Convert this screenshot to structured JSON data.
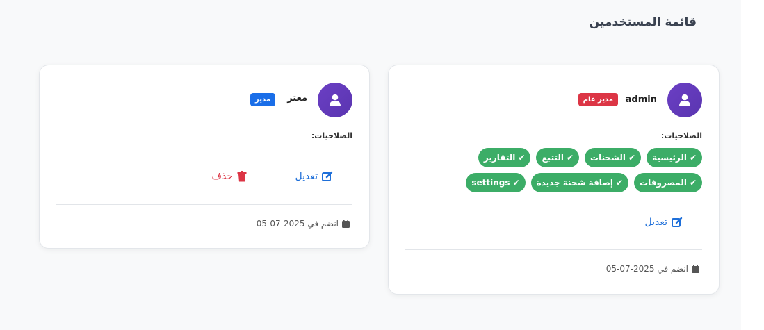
{
  "page": {
    "title": "قائمة المستخدمين"
  },
  "users": [
    {
      "name": "admin",
      "role": "مدير عام",
      "role_color": "#dc3545",
      "permissions_label": "الصلاحيات:",
      "permissions": [
        "الرئيسية",
        "الشحنات",
        "التتبع",
        "التقارير",
        "المصروفات",
        "إضافة شحنة جديدة",
        "settings"
      ],
      "edit_label": "تعديل",
      "joined_label": "انضم في 2025-07-05"
    },
    {
      "name": "معتز",
      "role": "مدير",
      "role_color": "#1a6ee8",
      "permissions_label": "الصلاحيات:",
      "permissions": [],
      "edit_label": "تعديل",
      "delete_label": "حذف",
      "joined_label": "انضم في 2025-07-05"
    }
  ],
  "icons": {
    "avatar": "user-icon",
    "check": "check-icon",
    "edit": "edit-icon",
    "delete": "trash-icon",
    "calendar": "calendar-icon"
  }
}
